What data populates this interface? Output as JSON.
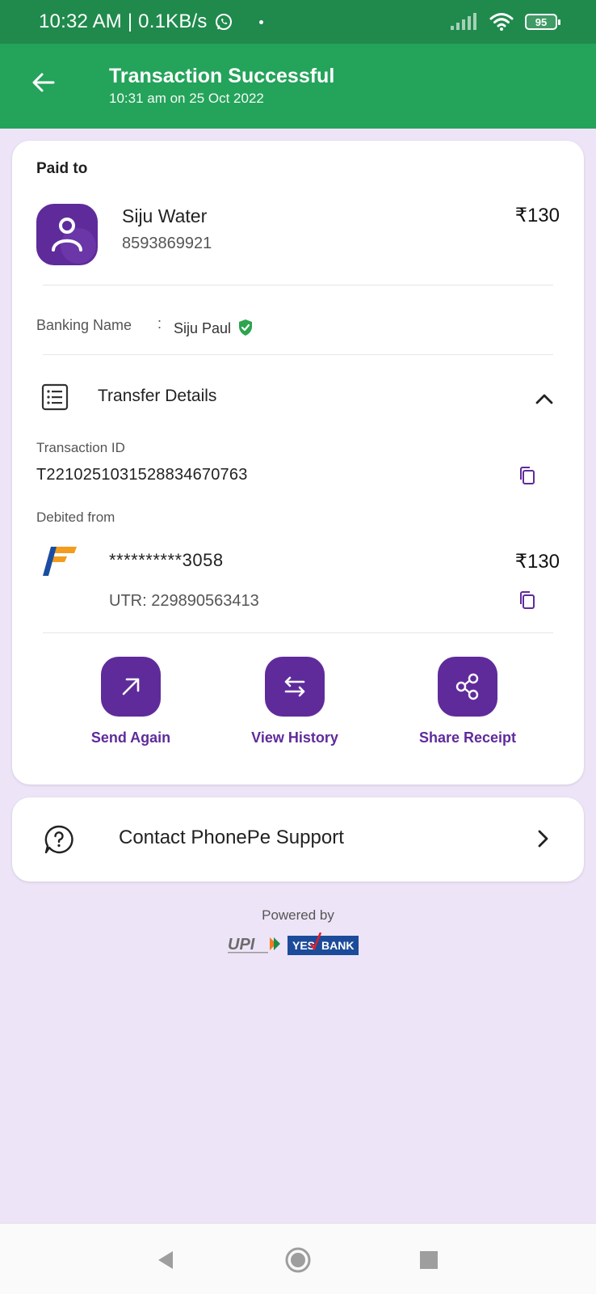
{
  "status_bar": {
    "time_text": "10:32 AM | 0.1KB/s",
    "battery": "95"
  },
  "header": {
    "title": "Transaction Successful",
    "subtitle": "10:31 am on 25 Oct 2022"
  },
  "payment": {
    "paid_to_label": "Paid to",
    "payee_name": "Siju Water",
    "payee_phone": "8593869921",
    "amount": "₹130",
    "banking_name_label": "Banking Name",
    "banking_name_sep": ":",
    "banking_name": "Siju Paul"
  },
  "transfer_details": {
    "title": "Transfer Details",
    "transaction_id_label": "Transaction ID",
    "transaction_id": "T2210251031528834670763",
    "debited_from_label": "Debited from",
    "account_masked": "**********3058",
    "debit_amount": "₹130",
    "utr": "UTR: 229890563413"
  },
  "actions": [
    {
      "label": "Send Again",
      "icon": "arrow-up-right-icon"
    },
    {
      "label": "View History",
      "icon": "swap-arrows-icon"
    },
    {
      "label": "Share Receipt",
      "icon": "share-icon"
    }
  ],
  "support": {
    "label": "Contact PhonePe Support"
  },
  "footer": {
    "powered_by": "Powered by",
    "upi_text": "UPI",
    "bank_logo_text_1": "YES",
    "bank_logo_text_2": "BANK"
  },
  "colors": {
    "status_bar": "#1f8a4c",
    "header": "#24a35a",
    "accent_purple": "#5f2b9b",
    "background": "#ede4f7"
  }
}
